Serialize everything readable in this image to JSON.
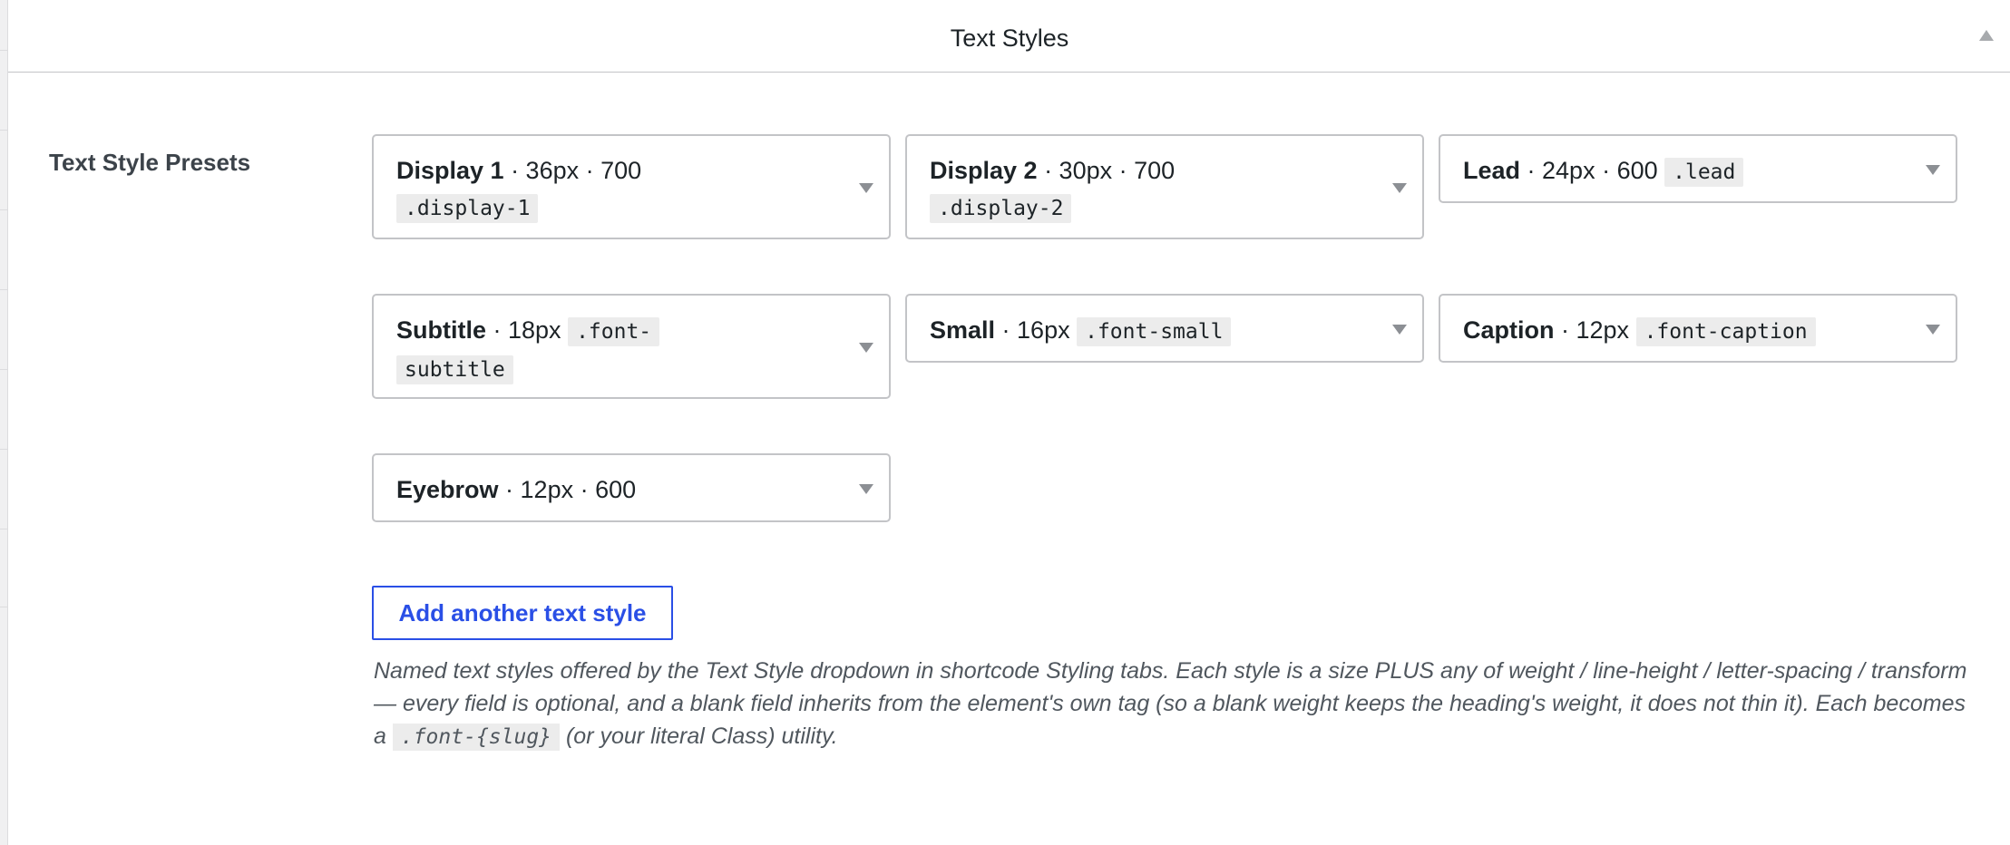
{
  "panel": {
    "title": "Text Styles"
  },
  "field": {
    "label": "Text Style Presets"
  },
  "presets": [
    {
      "name": "Display 1",
      "meta": " · 36px · 700",
      "class": ".display-1"
    },
    {
      "name": "Display 2",
      "meta": " · 30px · 700",
      "class": ".display-2"
    },
    {
      "name": "Lead",
      "meta": " · 24px · 600",
      "class": ".lead"
    },
    {
      "name": "Subtitle",
      "meta": " · 18px",
      "class_line1": ".font-",
      "class_line2": "subtitle"
    },
    {
      "name": "Small",
      "meta": " · 16px",
      "class": ".font-small"
    },
    {
      "name": "Caption",
      "meta": " · 12px",
      "class": ".font-caption"
    },
    {
      "name": "Eyebrow",
      "meta": " · 12px · 600"
    }
  ],
  "add_button": {
    "label": "Add another text style"
  },
  "help": {
    "part1": "Named text styles offered by the Text Style dropdown in shortcode Styling tabs. Each style is a size PLUS any of weight / line-height / letter-spacing / transform — every field is optional, and a blank field inherits from the element's own tag (so a blank weight keeps the heading's weight, it does not thin it). Each becomes a",
    "code": ".font-{slug}",
    "part2": "(or your literal Class) utility."
  }
}
